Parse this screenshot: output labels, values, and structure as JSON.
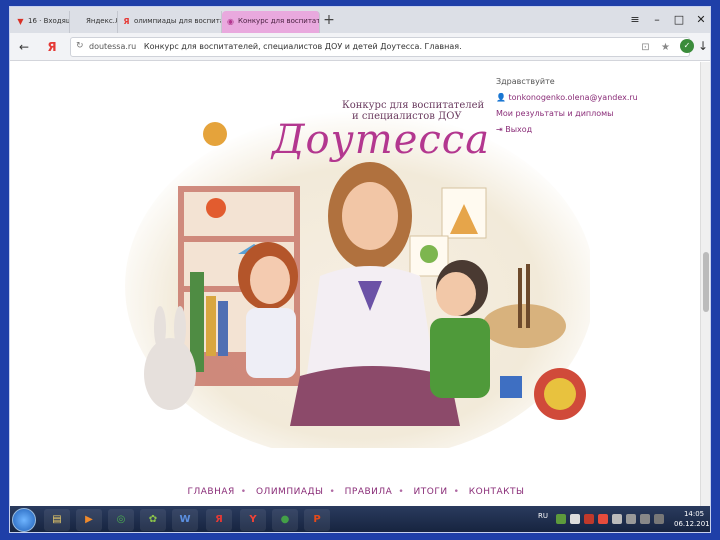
{
  "tabs": [
    {
      "label": "16 · Входящие",
      "icon": "mail-icon",
      "color": "#d93025"
    },
    {
      "label": "Яндекс.Л",
      "icon": "yandex-icon",
      "color": "#e53935"
    },
    {
      "label": "олимпиады для воспитател",
      "icon": "yandex-icon",
      "color": "#e53935"
    },
    {
      "label": "Конкурс для воспитател",
      "icon": "site-icon",
      "color": "#b3378f"
    }
  ],
  "browser": {
    "back_icon": "back-arrow-icon",
    "yandex_letter": "Я",
    "url_domain": "doutessa.ru",
    "url_title": "Конкурс для воспитателей, специалистов ДОУ и детей Доутесса. Главная."
  },
  "site": {
    "logo_small_line1": "Конкурс для воспитателей",
    "logo_small_line2": "и специалистов ДОУ",
    "logo_name": "Доутесса",
    "greeting": "Здравствуйте",
    "email": "tonkonogenko.olena@yandex.ru",
    "results_link": "Мои результаты и дипломы",
    "logout": "Выход"
  },
  "footer_nav": [
    "ГЛАВНАЯ",
    "ОЛИМПИАДЫ",
    "ПРАВИЛА",
    "ИТОГИ",
    "КОНТАКТЫ"
  ],
  "taskbar": {
    "lang": "RU",
    "time": "14:05",
    "date": "06.12.2017",
    "apps": [
      "explorer",
      "media",
      "chrome",
      "photo",
      "word",
      "yandex",
      "yandex-browser",
      "greenapp",
      "powerpoint"
    ]
  },
  "colors": {
    "accent": "#8a2d78",
    "brand": "#b3378f",
    "desktop": "#1f3fa8"
  }
}
